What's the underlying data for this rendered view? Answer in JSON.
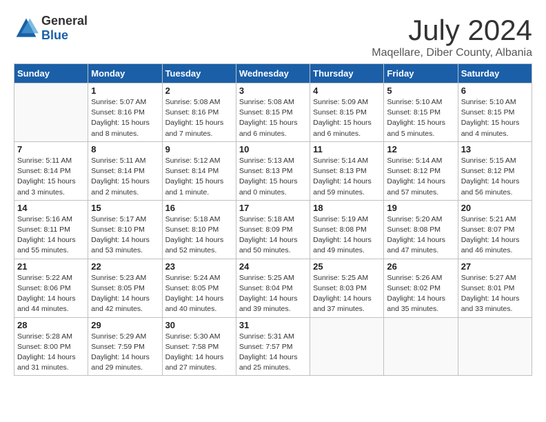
{
  "header": {
    "logo_general": "General",
    "logo_blue": "Blue",
    "month_title": "July 2024",
    "location": "Maqellare, Diber County, Albania"
  },
  "days_of_week": [
    "Sunday",
    "Monday",
    "Tuesday",
    "Wednesday",
    "Thursday",
    "Friday",
    "Saturday"
  ],
  "weeks": [
    [
      {
        "day": "",
        "info": ""
      },
      {
        "day": "1",
        "info": "Sunrise: 5:07 AM\nSunset: 8:16 PM\nDaylight: 15 hours\nand 8 minutes."
      },
      {
        "day": "2",
        "info": "Sunrise: 5:08 AM\nSunset: 8:16 PM\nDaylight: 15 hours\nand 7 minutes."
      },
      {
        "day": "3",
        "info": "Sunrise: 5:08 AM\nSunset: 8:15 PM\nDaylight: 15 hours\nand 6 minutes."
      },
      {
        "day": "4",
        "info": "Sunrise: 5:09 AM\nSunset: 8:15 PM\nDaylight: 15 hours\nand 6 minutes."
      },
      {
        "day": "5",
        "info": "Sunrise: 5:10 AM\nSunset: 8:15 PM\nDaylight: 15 hours\nand 5 minutes."
      },
      {
        "day": "6",
        "info": "Sunrise: 5:10 AM\nSunset: 8:15 PM\nDaylight: 15 hours\nand 4 minutes."
      }
    ],
    [
      {
        "day": "7",
        "info": "Sunrise: 5:11 AM\nSunset: 8:14 PM\nDaylight: 15 hours\nand 3 minutes."
      },
      {
        "day": "8",
        "info": "Sunrise: 5:11 AM\nSunset: 8:14 PM\nDaylight: 15 hours\nand 2 minutes."
      },
      {
        "day": "9",
        "info": "Sunrise: 5:12 AM\nSunset: 8:14 PM\nDaylight: 15 hours\nand 1 minute."
      },
      {
        "day": "10",
        "info": "Sunrise: 5:13 AM\nSunset: 8:13 PM\nDaylight: 15 hours\nand 0 minutes."
      },
      {
        "day": "11",
        "info": "Sunrise: 5:14 AM\nSunset: 8:13 PM\nDaylight: 14 hours\nand 59 minutes."
      },
      {
        "day": "12",
        "info": "Sunrise: 5:14 AM\nSunset: 8:12 PM\nDaylight: 14 hours\nand 57 minutes."
      },
      {
        "day": "13",
        "info": "Sunrise: 5:15 AM\nSunset: 8:12 PM\nDaylight: 14 hours\nand 56 minutes."
      }
    ],
    [
      {
        "day": "14",
        "info": "Sunrise: 5:16 AM\nSunset: 8:11 PM\nDaylight: 14 hours\nand 55 minutes."
      },
      {
        "day": "15",
        "info": "Sunrise: 5:17 AM\nSunset: 8:10 PM\nDaylight: 14 hours\nand 53 minutes."
      },
      {
        "day": "16",
        "info": "Sunrise: 5:18 AM\nSunset: 8:10 PM\nDaylight: 14 hours\nand 52 minutes."
      },
      {
        "day": "17",
        "info": "Sunrise: 5:18 AM\nSunset: 8:09 PM\nDaylight: 14 hours\nand 50 minutes."
      },
      {
        "day": "18",
        "info": "Sunrise: 5:19 AM\nSunset: 8:08 PM\nDaylight: 14 hours\nand 49 minutes."
      },
      {
        "day": "19",
        "info": "Sunrise: 5:20 AM\nSunset: 8:08 PM\nDaylight: 14 hours\nand 47 minutes."
      },
      {
        "day": "20",
        "info": "Sunrise: 5:21 AM\nSunset: 8:07 PM\nDaylight: 14 hours\nand 46 minutes."
      }
    ],
    [
      {
        "day": "21",
        "info": "Sunrise: 5:22 AM\nSunset: 8:06 PM\nDaylight: 14 hours\nand 44 minutes."
      },
      {
        "day": "22",
        "info": "Sunrise: 5:23 AM\nSunset: 8:05 PM\nDaylight: 14 hours\nand 42 minutes."
      },
      {
        "day": "23",
        "info": "Sunrise: 5:24 AM\nSunset: 8:05 PM\nDaylight: 14 hours\nand 40 minutes."
      },
      {
        "day": "24",
        "info": "Sunrise: 5:25 AM\nSunset: 8:04 PM\nDaylight: 14 hours\nand 39 minutes."
      },
      {
        "day": "25",
        "info": "Sunrise: 5:25 AM\nSunset: 8:03 PM\nDaylight: 14 hours\nand 37 minutes."
      },
      {
        "day": "26",
        "info": "Sunrise: 5:26 AM\nSunset: 8:02 PM\nDaylight: 14 hours\nand 35 minutes."
      },
      {
        "day": "27",
        "info": "Sunrise: 5:27 AM\nSunset: 8:01 PM\nDaylight: 14 hours\nand 33 minutes."
      }
    ],
    [
      {
        "day": "28",
        "info": "Sunrise: 5:28 AM\nSunset: 8:00 PM\nDaylight: 14 hours\nand 31 minutes."
      },
      {
        "day": "29",
        "info": "Sunrise: 5:29 AM\nSunset: 7:59 PM\nDaylight: 14 hours\nand 29 minutes."
      },
      {
        "day": "30",
        "info": "Sunrise: 5:30 AM\nSunset: 7:58 PM\nDaylight: 14 hours\nand 27 minutes."
      },
      {
        "day": "31",
        "info": "Sunrise: 5:31 AM\nSunset: 7:57 PM\nDaylight: 14 hours\nand 25 minutes."
      },
      {
        "day": "",
        "info": ""
      },
      {
        "day": "",
        "info": ""
      },
      {
        "day": "",
        "info": ""
      }
    ]
  ]
}
